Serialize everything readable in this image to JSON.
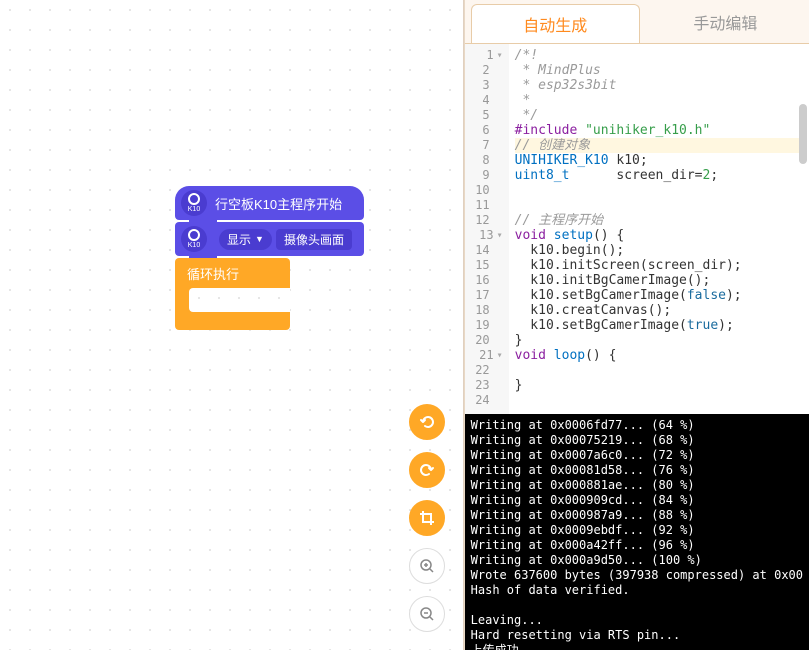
{
  "blocks": {
    "hat_label": "行空板K10主程序开始",
    "display_label": "显示",
    "camera_label": "摄像头画面",
    "loop_label": "循环执行",
    "badge_text": "K10"
  },
  "tabs": {
    "auto": "自动生成",
    "manual": "手动编辑"
  },
  "code_lines": [
    {
      "n": 1,
      "fold": "▾",
      "html": "<span class='c-comment'>/*!</span>"
    },
    {
      "n": 2,
      "html": "<span class='c-comment'> * MindPlus</span>"
    },
    {
      "n": 3,
      "html": "<span class='c-comment'> * esp32s3bit</span>"
    },
    {
      "n": 4,
      "html": "<span class='c-comment'> *</span>"
    },
    {
      "n": 5,
      "html": "<span class='c-comment'> */</span>"
    },
    {
      "n": 6,
      "html": "<span class='c-keyword'>#include</span> <span class='c-string'>\"unihiker_k10.h\"</span>"
    },
    {
      "n": 7,
      "hl": true,
      "html": "<span class='c-comment'>// 创建对象</span>"
    },
    {
      "n": 8,
      "html": "<span class='c-type'>UNIHIKER_K10</span> k10;"
    },
    {
      "n": 9,
      "html": "<span class='c-type'>uint8_t</span>      screen_dir=<span class='c-num'>2</span>;"
    },
    {
      "n": 10,
      "html": ""
    },
    {
      "n": 11,
      "html": ""
    },
    {
      "n": 12,
      "html": "<span class='c-comment'>// 主程序开始</span>"
    },
    {
      "n": 13,
      "fold": "▾",
      "html": "<span class='c-keyword'>void</span> <span class='c-type'>setup</span>() {"
    },
    {
      "n": 14,
      "html": "  k10.begin();"
    },
    {
      "n": 15,
      "html": "  k10.initScreen(screen_dir);"
    },
    {
      "n": 16,
      "html": "  k10.initBgCamerImage();"
    },
    {
      "n": 17,
      "html": "  k10.setBgCamerImage(<span class='c-bool'>false</span>);"
    },
    {
      "n": 18,
      "html": "  k10.creatCanvas();"
    },
    {
      "n": 19,
      "html": "  k10.setBgCamerImage(<span class='c-bool'>true</span>);"
    },
    {
      "n": 20,
      "html": "}"
    },
    {
      "n": 21,
      "fold": "▾",
      "html": "<span class='c-keyword'>void</span> <span class='c-type'>loop</span>() {"
    },
    {
      "n": 22,
      "html": ""
    },
    {
      "n": 23,
      "html": "}"
    },
    {
      "n": 24,
      "html": ""
    }
  ],
  "console_lines": [
    "Writing at 0x0006fd77... (64 %)",
    "Writing at 0x00075219... (68 %)",
    "Writing at 0x0007a6c0... (72 %)",
    "Writing at 0x00081d58... (76 %)",
    "Writing at 0x000881ae... (80 %)",
    "Writing at 0x000909cd... (84 %)",
    "Writing at 0x000987a9... (88 %)",
    "Writing at 0x0009ebdf... (92 %)",
    "Writing at 0x000a42ff... (96 %)",
    "Writing at 0x000a9d50... (100 %)",
    "Wrote 637600 bytes (397938 compressed) at 0x00",
    "Hash of data verified.",
    "",
    "Leaving...",
    "Hard resetting via RTS pin...",
    "上传成功"
  ],
  "chart_data": null
}
